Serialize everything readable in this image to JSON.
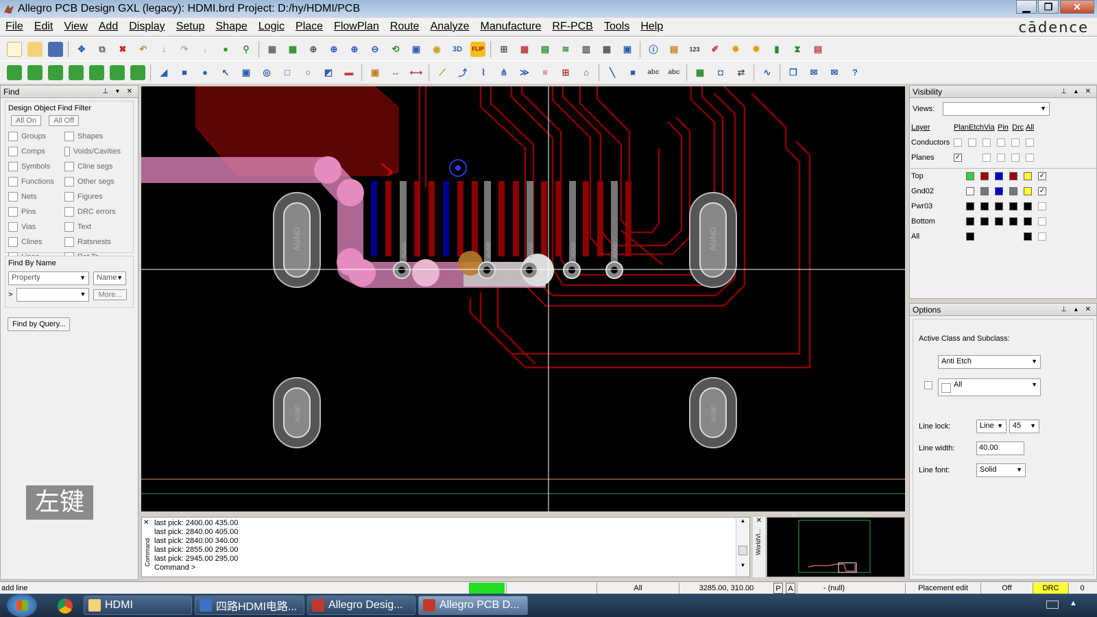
{
  "window": {
    "title": "Allegro PCB Design GXL (legacy): HDMI.brd  Project: D:/hy/HDMI/PCB",
    "min": "▁",
    "max": "❐",
    "close": "✕"
  },
  "brand": "cādence",
  "menu": [
    "File",
    "Edit",
    "View",
    "Add",
    "Display",
    "Setup",
    "Shape",
    "Logic",
    "Place",
    "FlowPlan",
    "Route",
    "Analyze",
    "Manufacture",
    "RF-PCB",
    "Tools",
    "Help"
  ],
  "find": {
    "title": "Find",
    "filter_title": "Design Object Find Filter",
    "all_on": "All On",
    "all_off": "All Off",
    "items_left": [
      "Groups",
      "Comps",
      "Symbols",
      "Functions",
      "Nets",
      "Pins",
      "Vias",
      "Clines",
      "Lines"
    ],
    "items_right": [
      "Shapes",
      "Voids/Cavities",
      "Cline segs",
      "Other segs",
      "Figures",
      "DRC errors",
      "Text",
      "Ratsnests",
      "Rat Ts"
    ],
    "by_name": "Find By Name",
    "property": "Property",
    "name": "Name",
    "more": "More...",
    "find_by_query": "Find by Query...",
    "prompt": ">"
  },
  "visibility": {
    "title": "Visibility",
    "views": "Views:",
    "cols": [
      "Layer",
      "Plan",
      "Etch",
      "Via",
      "Pin",
      "Drc",
      "All"
    ],
    "rows": [
      "Conductors",
      "Planes",
      "Top",
      "Gnd02",
      "Pwr03",
      "Bottom",
      "All"
    ]
  },
  "options": {
    "title": "Options",
    "active_class": "Active Class and Subclass:",
    "class": "Anti Etch",
    "subclass": "All",
    "line_lock": "Line lock:",
    "line_lock_val": "Line",
    "angle": "45",
    "line_width": "Line width:",
    "line_width_val": "40.00",
    "line_font": "Line font:",
    "line_font_val": "Solid"
  },
  "pcb": {
    "pad_label": "AGND",
    "pin_label": "AGND"
  },
  "command": {
    "lines": [
      "last pick:  2400.00 435.00",
      "last pick:  2840.00 405.00",
      "last pick:  2840.00 340.00",
      "last pick:  2855.00 295.00",
      "last pick:  2945.00 295.00",
      "Command >"
    ],
    "side_label": "Command",
    "world_label": "WorldVi..."
  },
  "status": {
    "mode": "add line",
    "layer": "All",
    "coords": "3285.00, 310.00",
    "p": "P",
    "a": "A",
    "null": "- (null)",
    "edit": "Placement edit",
    "off": "Off",
    "drc": "DRC",
    "count": "0"
  },
  "overlay": "左键",
  "taskbar": [
    "HDMI",
    "四路HDMI电路...",
    "Allegro Desig...",
    "Allegro PCB D..."
  ],
  "colors": {
    "trace": "#8b0000",
    "pink": "#e58bc0",
    "blue": "#0000cc",
    "drc": "#ffff33"
  }
}
